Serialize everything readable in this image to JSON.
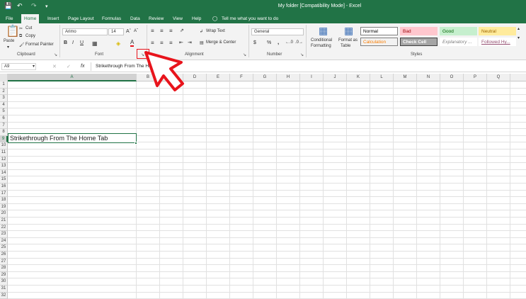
{
  "window": {
    "title": "My folder [Compatibility Mode] - Excel"
  },
  "tabs": [
    {
      "label": "File",
      "active": false
    },
    {
      "label": "Home",
      "active": true
    },
    {
      "label": "Insert",
      "active": false
    },
    {
      "label": "Page Layout",
      "active": false
    },
    {
      "label": "Formulas",
      "active": false
    },
    {
      "label": "Data",
      "active": false
    },
    {
      "label": "Review",
      "active": false
    },
    {
      "label": "View",
      "active": false
    },
    {
      "label": "Help",
      "active": false
    }
  ],
  "tell_me": "Tell me what you want to do",
  "clipboard": {
    "paste": "Paste",
    "cut": "Cut",
    "copy": "Copy",
    "format_painter": "Format Painter",
    "label": "Clipboard"
  },
  "font": {
    "name": "Arimo",
    "size": "14",
    "label": "Font",
    "bold": "B",
    "italic": "I",
    "underline": "U",
    "font_color": "A"
  },
  "alignment": {
    "wrap_text": "Wrap Text",
    "merge_center": "Merge & Center",
    "label": "Alignment"
  },
  "number": {
    "format": "General",
    "label": "Number",
    "currency": "$",
    "percent": "%",
    "comma": ","
  },
  "styles": {
    "conditional": "Conditional",
    "conditional2": "Formatting",
    "format_as": "Format as",
    "format_as2": "Table",
    "label": "Styles",
    "cells": [
      {
        "label": "Normal",
        "bg": "#ffffff",
        "fg": "#000000",
        "border": "#7f7f7f"
      },
      {
        "label": "Bad",
        "bg": "#ffc7ce",
        "fg": "#9c0006",
        "border": "#ffc7ce"
      },
      {
        "label": "Good",
        "bg": "#c6efce",
        "fg": "#006100",
        "border": "#c6efce"
      },
      {
        "label": "Neutral",
        "bg": "#ffeb9c",
        "fg": "#9c6500",
        "border": "#ffeb9c"
      },
      {
        "label": "Calculation",
        "bg": "#f2f2f2",
        "fg": "#fa7d00",
        "border": "#7f7f7f"
      },
      {
        "label": "Check Cell",
        "bg": "#a5a5a5",
        "fg": "#ffffff",
        "border": "#3f3f3f"
      },
      {
        "label": "Explanatory ...",
        "bg": "#ffffff",
        "fg": "#7f7f7f",
        "border": "#ffffff"
      },
      {
        "label": "Followed Hy...",
        "bg": "#ffffff",
        "fg": "#954f72",
        "border": "#ffffff"
      }
    ]
  },
  "formula_bar": {
    "name_box": "A9",
    "fx": "fx",
    "content": "Strikethrough From The Home Tab"
  },
  "columns": [
    "A",
    "B",
    "C",
    "D",
    "E",
    "F",
    "G",
    "H",
    "I",
    "J",
    "K",
    "L",
    "M",
    "N",
    "O",
    "P",
    "Q"
  ],
  "rows": [
    "1",
    "2",
    "3",
    "4",
    "5",
    "6",
    "7",
    "8",
    "9",
    "10",
    "11",
    "12",
    "13",
    "14",
    "15",
    "16",
    "17",
    "18",
    "19",
    "20",
    "21",
    "22",
    "23",
    "24",
    "25",
    "26",
    "27",
    "28",
    "29",
    "30",
    "31",
    "32"
  ],
  "cells": {
    "A9": "Strikethrough From The Home Tab"
  },
  "colors": {
    "excel_green": "#217346",
    "annotation_red": "#e8141c"
  }
}
